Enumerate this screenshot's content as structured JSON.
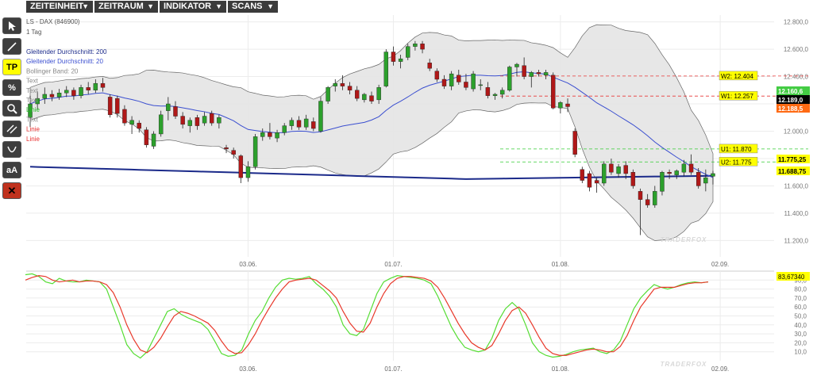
{
  "menu": [
    {
      "label": "ZEITEINHEIT"
    },
    {
      "label": "ZEITRAUM"
    },
    {
      "label": "INDIKATOR"
    },
    {
      "label": "SCANS"
    }
  ],
  "menu_arrow": "▼",
  "toolbar": {
    "items": [
      {
        "name": "pointer-tool-icon",
        "glyph": ""
      },
      {
        "name": "line-tool-icon",
        "glyph": ""
      },
      {
        "name": "tp-tool-button",
        "glyph": "TP"
      },
      {
        "name": "percent-tool-icon",
        "glyph": "%"
      },
      {
        "name": "zoom-tool-icon",
        "glyph": ""
      },
      {
        "name": "channel-tool-icon",
        "glyph": ""
      },
      {
        "name": "curve-tool-icon",
        "glyph": ""
      },
      {
        "name": "text-size-tool-button",
        "glyph": "aA"
      },
      {
        "name": "delete-tool-icon",
        "glyph": "✕"
      }
    ]
  },
  "colors": {
    "accent_yellow": "#ffff00",
    "up": "#2ca02c",
    "down": "#b01818",
    "sma20": "#3b4fd0",
    "sma200": "#1b2a8a",
    "boll_fill": "#e6e6e6",
    "stoch_k": "#55dd33",
    "stoch_d": "#e8382a",
    "resistance": "#e83838",
    "support": "#33cc33"
  },
  "legend": {
    "instrument": "LS - DAX (846900)",
    "period": "1 Tag",
    "items": [
      {
        "label": "Gleitender Durchschnitt: 200",
        "color": "#1b2a8a"
      },
      {
        "label": "Gleitender Durchschnitt: 20",
        "color": "#3b4fd0"
      },
      {
        "label": "Bollinger Band: 20",
        "color": "#888888"
      },
      {
        "label": "Text",
        "color": "#888888"
      },
      {
        "label": "Text",
        "color": "#888888"
      },
      {
        "label": "Text",
        "color": "#888888"
      },
      {
        "label": "Linie",
        "color": "#22bb22"
      },
      {
        "label": "Text",
        "color": "#888888"
      },
      {
        "label": "Linie",
        "color": "#e83030"
      },
      {
        "label": "Linie",
        "color": "#e83030"
      }
    ]
  },
  "watermark": "TRADERFOX",
  "chart_data": [
    {
      "type": "candlestick",
      "y_ticks": [
        11200,
        11400,
        11600,
        11800,
        12000,
        12200,
        12400,
        12600,
        12800
      ],
      "y_tick_labels": [
        "11.200,0",
        "11.400,0",
        "11.600,0",
        "11.800,0",
        "12.000,0",
        "12.200,0",
        "12.400,0",
        "12.600,0",
        "12.800,0"
      ],
      "ylim": [
        11150,
        12850
      ],
      "x_tick_labels": [
        {
          "label": "03.06.",
          "index": 30
        },
        {
          "label": "01.07.",
          "index": 50
        },
        {
          "label": "01.08.",
          "index": 73
        },
        {
          "label": "02.09.",
          "index": 95
        }
      ],
      "candles": [
        [
          12100,
          12260,
          12030,
          12200
        ],
        [
          12200,
          12290,
          12160,
          12240
        ],
        [
          12240,
          12320,
          12200,
          12270
        ],
        [
          12270,
          12300,
          12220,
          12250
        ],
        [
          12250,
          12310,
          12230,
          12280
        ],
        [
          12280,
          12330,
          12250,
          12300
        ],
        [
          12300,
          12320,
          12230,
          12260
        ],
        [
          12260,
          12340,
          12240,
          12320
        ],
        [
          12320,
          12360,
          12270,
          12300
        ],
        [
          12300,
          12380,
          12280,
          12350
        ],
        [
          12350,
          12390,
          12290,
          12320
        ],
        [
          12250,
          12270,
          12100,
          12120
        ],
        [
          12240,
          12260,
          12100,
          12130
        ],
        [
          12160,
          12190,
          12040,
          12060
        ],
        [
          12050,
          12110,
          11980,
          12080
        ],
        [
          12060,
          12080,
          11990,
          12020
        ],
        [
          12010,
          12030,
          11880,
          11900
        ],
        [
          11890,
          12000,
          11870,
          11980
        ],
        [
          11980,
          12150,
          11960,
          12120
        ],
        [
          12150,
          12250,
          12080,
          12200
        ],
        [
          12180,
          12220,
          12090,
          12110
        ],
        [
          12110,
          12140,
          12020,
          12050
        ],
        [
          12040,
          12100,
          11990,
          12080
        ],
        [
          12100,
          12120,
          12010,
          12040
        ],
        [
          12060,
          12140,
          12040,
          12110
        ],
        [
          12130,
          12150,
          12040,
          12060
        ],
        [
          12060,
          12120,
          12020,
          12100
        ],
        [
          11880,
          11900,
          11840,
          11870
        ],
        [
          11860,
          11880,
          11800,
          11830
        ],
        [
          11820,
          11830,
          11620,
          11660
        ],
        [
          11660,
          11780,
          11630,
          11740
        ],
        [
          11740,
          11980,
          11720,
          11960
        ],
        [
          11960,
          12020,
          11930,
          11990
        ],
        [
          11990,
          12060,
          11940,
          11960
        ],
        [
          11950,
          12010,
          11920,
          11990
        ],
        [
          11990,
          12060,
          11970,
          12040
        ],
        [
          12040,
          12100,
          12010,
          12080
        ],
        [
          12080,
          12110,
          12010,
          12030
        ],
        [
          12030,
          12120,
          12010,
          12090
        ],
        [
          12070,
          12100,
          12000,
          12020
        ],
        [
          12000,
          12250,
          11990,
          12220
        ],
        [
          12220,
          12330,
          12200,
          12320
        ],
        [
          12330,
          12380,
          12290,
          12350
        ],
        [
          12350,
          12410,
          12300,
          12330
        ],
        [
          12330,
          12360,
          12270,
          12300
        ],
        [
          12300,
          12330,
          12220,
          12240
        ],
        [
          12230,
          12280,
          12210,
          12270
        ],
        [
          12260,
          12290,
          12200,
          12220
        ],
        [
          12230,
          12340,
          12200,
          12320
        ],
        [
          12330,
          12600,
          12320,
          12580
        ],
        [
          12580,
          12620,
          12480,
          12510
        ],
        [
          12510,
          12560,
          12460,
          12530
        ],
        [
          12540,
          12640,
          12520,
          12620
        ],
        [
          12620,
          12660,
          12590,
          12640
        ],
        [
          12640,
          12660,
          12570,
          12600
        ],
        [
          12500,
          12530,
          12440,
          12460
        ],
        [
          12440,
          12460,
          12360,
          12380
        ],
        [
          12380,
          12410,
          12310,
          12330
        ],
        [
          12330,
          12440,
          12300,
          12420
        ],
        [
          12410,
          12450,
          12340,
          12360
        ],
        [
          12360,
          12420,
          12300,
          12320
        ],
        [
          12310,
          12440,
          12290,
          12420
        ],
        [
          12340,
          12380,
          12300,
          12340
        ],
        [
          12320,
          12360,
          12240,
          12260
        ],
        [
          12260,
          12280,
          12230,
          12270
        ],
        [
          12270,
          12320,
          12240,
          12300
        ],
        [
          12300,
          12480,
          12290,
          12470
        ],
        [
          12470,
          12500,
          12400,
          12490
        ],
        [
          12480,
          12540,
          12380,
          12400
        ],
        [
          12400,
          12440,
          12320,
          12430
        ],
        [
          12430,
          12450,
          12400,
          12420
        ],
        [
          12410,
          12450,
          12380,
          12430
        ],
        [
          12410,
          12430,
          12160,
          12170
        ],
        [
          12170,
          12220,
          12130,
          12210
        ],
        [
          12200,
          12240,
          12140,
          12180
        ],
        [
          12000,
          12020,
          11810,
          11830
        ],
        [
          11720,
          11740,
          11620,
          11640
        ],
        [
          11690,
          11710,
          11560,
          11590
        ],
        [
          11640,
          11660,
          11550,
          11620
        ],
        [
          11620,
          11780,
          11600,
          11760
        ],
        [
          11760,
          11800,
          11680,
          11700
        ],
        [
          11690,
          11760,
          11660,
          11740
        ],
        [
          11750,
          11780,
          11650,
          11690
        ],
        [
          11700,
          11720,
          11580,
          11600
        ],
        [
          11560,
          11580,
          11240,
          11500
        ],
        [
          11500,
          11540,
          11440,
          11460
        ],
        [
          11460,
          11600,
          11440,
          11560
        ],
        [
          11560,
          11710,
          11530,
          11700
        ],
        [
          11700,
          11720,
          11650,
          11690
        ],
        [
          11680,
          11720,
          11650,
          11710
        ],
        [
          11700,
          11790,
          11670,
          11760
        ],
        [
          11760,
          11830,
          11680,
          11700
        ],
        [
          11700,
          11730,
          11580,
          11600
        ],
        [
          11620,
          11720,
          11560,
          11660
        ],
        [
          11670,
          11710,
          11610,
          11690
        ]
      ]
    },
    {
      "type": "line",
      "series": [
        {
          "name": "%K"
        },
        {
          "name": "%D"
        }
      ],
      "y_ticks": [
        10,
        20,
        30,
        40,
        50,
        60,
        70,
        80,
        90
      ],
      "y_tick_labels": [
        "10,0",
        "20,0",
        "30,0",
        "40,0",
        "50,0",
        "60,0",
        "70,0",
        "80,0",
        "90,0"
      ],
      "ylim": [
        0,
        100
      ],
      "x_tick_labels": [
        "03.06.",
        "01.07.",
        "01.08.",
        "02.09."
      ],
      "k": [
        96,
        97,
        94,
        88,
        86,
        92,
        89,
        88,
        88,
        90,
        89,
        88,
        80,
        60,
        40,
        18,
        8,
        3,
        10,
        25,
        40,
        55,
        58,
        52,
        48,
        45,
        42,
        35,
        22,
        8,
        5,
        6,
        12,
        30,
        45,
        55,
        70,
        82,
        90,
        92,
        91,
        92,
        94,
        86,
        80,
        72,
        60,
        40,
        30,
        28,
        35,
        55,
        75,
        88,
        92,
        95,
        94,
        93,
        92,
        90,
        86,
        72,
        55,
        38,
        25,
        15,
        12,
        10,
        12,
        25,
        45,
        58,
        65,
        58,
        40,
        20,
        10,
        6,
        4,
        5,
        7,
        10,
        12,
        13,
        14,
        10,
        8,
        12,
        22,
        40,
        58,
        70,
        78,
        85,
        82,
        80,
        82,
        85,
        87,
        88,
        87,
        88
      ],
      "d": [
        90,
        93,
        95,
        94,
        90,
        88,
        89,
        90,
        88,
        89,
        89,
        88,
        85,
        76,
        60,
        40,
        24,
        12,
        9,
        15,
        25,
        38,
        50,
        55,
        53,
        50,
        46,
        42,
        34,
        22,
        12,
        8,
        9,
        18,
        30,
        45,
        58,
        70,
        80,
        88,
        90,
        91,
        92,
        90,
        84,
        78,
        70,
        55,
        42,
        33,
        32,
        42,
        60,
        75,
        86,
        92,
        94,
        94,
        93,
        92,
        89,
        82,
        70,
        56,
        42,
        30,
        20,
        15,
        12,
        17,
        30,
        45,
        56,
        60,
        53,
        40,
        26,
        14,
        8,
        6,
        6,
        8,
        10,
        12,
        13,
        12,
        10,
        10,
        16,
        28,
        45,
        60,
        70,
        80,
        82,
        82,
        82,
        84,
        86,
        87,
        87,
        88
      ]
    }
  ],
  "levels": [
    {
      "label": "W2: 12.404",
      "value": 12404,
      "kind": "resistance"
    },
    {
      "label": "W1: 12.257",
      "value": 12257,
      "kind": "resistance"
    },
    {
      "label": "U1: 11.870",
      "value": 11870,
      "kind": "support"
    },
    {
      "label": "U2: 11.775",
      "value": 11775,
      "kind": "support"
    }
  ],
  "price_tags": [
    {
      "label": "12.160,6",
      "value": 12160,
      "bg": "#44cc44",
      "fg": "#ffffff"
    },
    {
      "label": "12.189,0",
      "value": 12189,
      "bg": "#000000",
      "fg": "#ffffff"
    },
    {
      "label": "12.188,5",
      "value": 12188,
      "bg": "#ff6a13",
      "fg": "#ffffff"
    },
    {
      "label": "11.775,25",
      "value": 11775,
      "bg": "#ffff00",
      "fg": "#000000"
    },
    {
      "label": "11.688,75",
      "value": 11688,
      "bg": "#ffff00",
      "fg": "#000000"
    }
  ],
  "osc_tag": {
    "label": "83,67340",
    "bg": "#ffff00",
    "fg": "#000000"
  }
}
